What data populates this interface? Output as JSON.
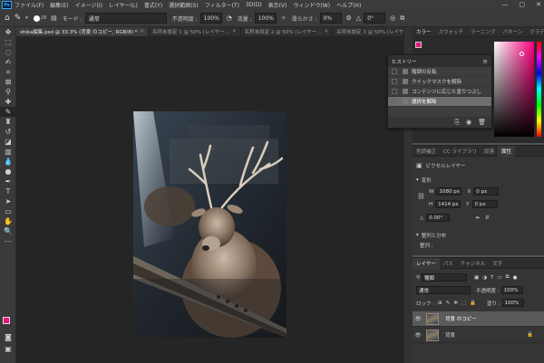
{
  "menubar": {
    "logo": "Ps",
    "items": [
      "ファイル(F)",
      "編集(E)",
      "イメージ(I)",
      "レイヤー(L)",
      "書式(Y)",
      "選択範囲(S)",
      "フィルター(T)",
      "3D(D)",
      "表示(V)",
      "ウィンドウ(W)",
      "ヘルプ(H)"
    ],
    "window_controls": [
      "—",
      "▢",
      "✕"
    ]
  },
  "options": {
    "brush_size": "28",
    "mode_label": "モード :",
    "mode_value": "通常",
    "opacity_label": "不透明度 :",
    "opacity_value": "100%",
    "flow_label": "流量 :",
    "flow_value": "100%",
    "smoothing_label": "滑らかさ :",
    "smoothing_value": "0%",
    "angle_value": "0°"
  },
  "doc_tabs": [
    {
      "label": "shika編集.psd @ 33.3% (背景 のコピー, RGB/8) *",
      "active": true
    },
    {
      "label": "名称未設定 1 @ 50% (レイヤー...",
      "active": false
    },
    {
      "label": "名称未設定 2 @ 50% (レイヤー...",
      "active": false
    },
    {
      "label": "名称未設定 3 @ 50% (レイヤー...",
      "active": false
    }
  ],
  "color_panel": {
    "tabs": [
      "カラー",
      "スウォッチ",
      "ラーニング",
      "パターン",
      "グラデーション"
    ],
    "foreground": "#e8137c",
    "background": "#ffffff"
  },
  "history": {
    "title": "ヒストリー",
    "items": [
      {
        "label": "階調の反転",
        "selected": false
      },
      {
        "label": "クイックマスクを解除",
        "selected": false
      },
      {
        "label": "コンテンツに応じた塗りつぶし",
        "selected": false
      },
      {
        "label": "選択を解除",
        "selected": true
      }
    ]
  },
  "properties": {
    "tabs": [
      "色調補正",
      "CC ライブラリ",
      "段落",
      "属性"
    ],
    "layer_type": "ピクセルレイヤー",
    "transform_title": "変形",
    "w_label": "W",
    "w_value": "1080 px",
    "h_label": "H",
    "h_value": "1414 px",
    "x_label": "X",
    "x_value": "0 px",
    "y_label": "Y",
    "y_value": "0 px",
    "angle_value": "0.00°",
    "align_title": "整列と分布",
    "align_sub": "整列 :"
  },
  "layers": {
    "tabs": [
      "レイヤー",
      "パス",
      "チャンネル",
      "文字"
    ],
    "filter_value": "種類",
    "blend_mode": "通常",
    "opacity_label": "不透明度 :",
    "opacity_value": "100%",
    "lock_label": "ロック :",
    "fill_label": "塗り :",
    "fill_value": "100%",
    "rows": [
      {
        "name": "背景 のコピー",
        "selected": true
      },
      {
        "name": "背景",
        "selected": false
      }
    ]
  }
}
